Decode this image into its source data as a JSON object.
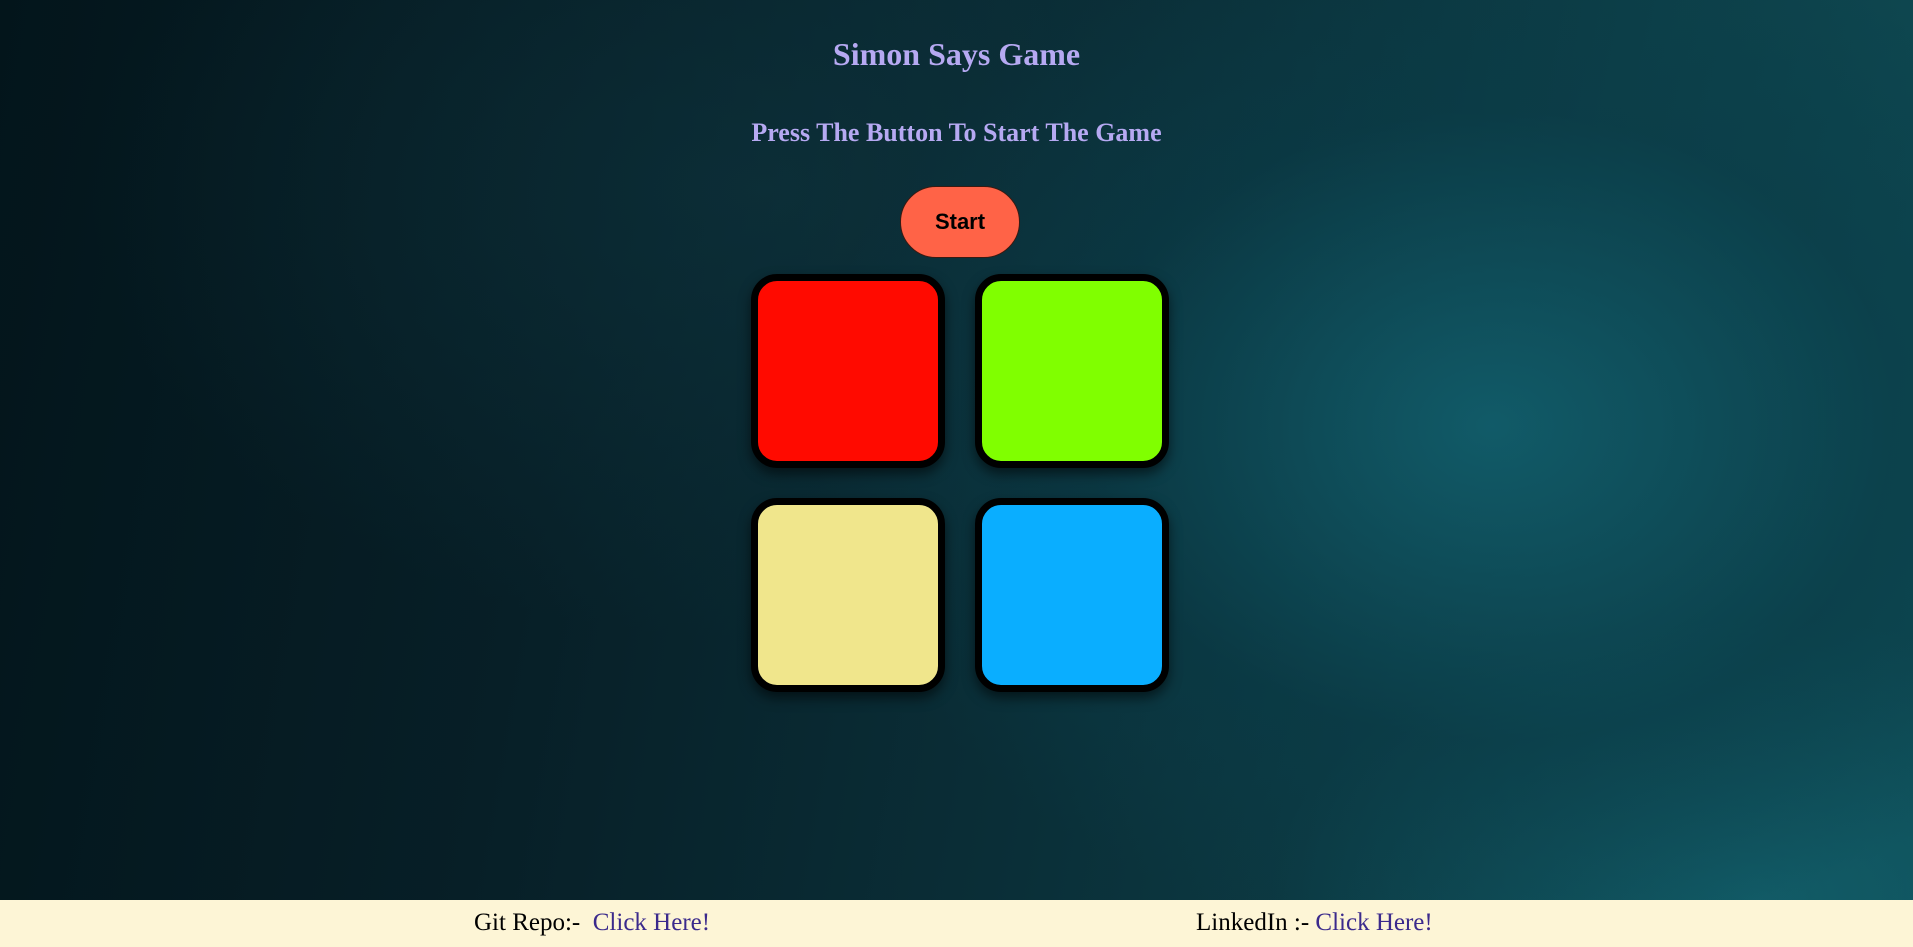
{
  "game": {
    "title": "Simon Says Game",
    "status": "Press The Button To Start The Game",
    "start_label": "Start",
    "start_color": "#ff6347",
    "pads": [
      {
        "name": "red",
        "color": "#ff0a00"
      },
      {
        "name": "green",
        "color": "#80ff00"
      },
      {
        "name": "yellow",
        "color": "#f0e68c"
      },
      {
        "name": "blue",
        "color": "#0aaeff"
      }
    ]
  },
  "footer": {
    "git_label": "Git Repo:- ",
    "git_link": "Click Here!",
    "linkedin_label": "LinkedIn :- ",
    "linkedin_link": "Click Here!",
    "background": "#fdf5d6"
  }
}
